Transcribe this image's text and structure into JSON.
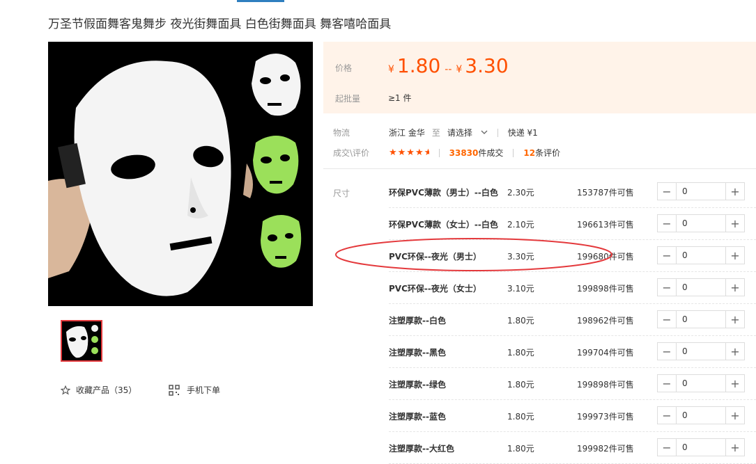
{
  "title": "万圣节假面舞客鬼舞步 夜光街舞面具 白色街舞面具 舞客嘻哈面具",
  "price_panel": {
    "price_label": "价格",
    "currency": "¥",
    "price_low": "1.80",
    "price_sep": "--",
    "price_high": "3.30",
    "moq_label": "起批量",
    "moq_value": "≥1 件"
  },
  "logistics": {
    "label": "物流",
    "origin": "浙江 金华",
    "to": "至",
    "dest": "请选择",
    "method": "快递 ¥1"
  },
  "trade": {
    "label": "成交\\评价",
    "rating": 4.5,
    "deals_count": "33830",
    "deals_unit": "件成交",
    "reviews_count": "12",
    "reviews_unit": "条评价"
  },
  "actions": {
    "favorite": "收藏产品（35）",
    "mobile_order": "手机下单"
  },
  "size_label": "尺寸",
  "skus": [
    {
      "name": "环保PVC薄款（男士）--白色",
      "price": "2.30元",
      "stock": "153787件可售",
      "qty": "0"
    },
    {
      "name": "环保PVC薄款（女士）--白色",
      "price": "2.10元",
      "stock": "196613件可售",
      "qty": "0"
    },
    {
      "name": "PVC环保--夜光（男士）",
      "price": "3.30元",
      "stock": "199680件可售",
      "qty": "0"
    },
    {
      "name": "PVC环保--夜光（女士）",
      "price": "3.10元",
      "stock": "199898件可售",
      "qty": "0"
    },
    {
      "name": "注塑厚款--白色",
      "price": "1.80元",
      "stock": "198962件可售",
      "qty": "0"
    },
    {
      "name": "注塑厚款--黑色",
      "price": "1.80元",
      "stock": "199704件可售",
      "qty": "0"
    },
    {
      "name": "注塑厚款--绿色",
      "price": "1.80元",
      "stock": "199898件可售",
      "qty": "0"
    },
    {
      "name": "注塑厚款--蓝色",
      "price": "1.80元",
      "stock": "199973件可售",
      "qty": "0"
    },
    {
      "name": "注塑厚款--大红色",
      "price": "1.80元",
      "stock": "199982件可售",
      "qty": "0"
    }
  ],
  "colors": {
    "price_orange": "#ff5000",
    "panel_bg": "#fff3e9",
    "annotation_red": "#e4393c",
    "mask_green": "#9be05a"
  }
}
